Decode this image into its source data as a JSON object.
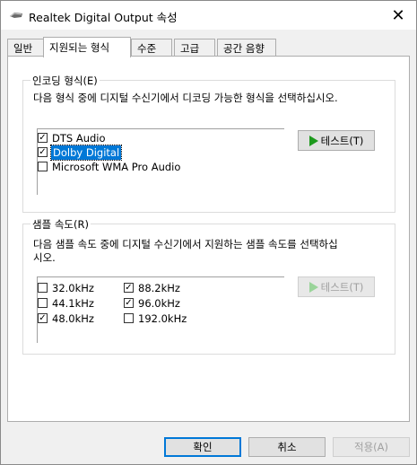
{
  "window": {
    "title": "Realtek Digital Output 속성",
    "close_glyph": "✕"
  },
  "tabs": [
    {
      "label": "일반"
    },
    {
      "label": "지원되는 형식",
      "active": true
    },
    {
      "label": "수준"
    },
    {
      "label": "고급"
    },
    {
      "label": "공간 음향"
    }
  ],
  "encoding": {
    "group_label": "인코딩 형식(E)",
    "description": "다음 형식 중에 디지털 수신기에서 디코딩 가능한 형식을 선택하십시오.",
    "formats": [
      {
        "label": "DTS Audio",
        "checked": true
      },
      {
        "label": "Dolby Digital",
        "checked": true,
        "selected": true
      },
      {
        "label": "Microsoft WMA Pro Audio",
        "checked": false
      }
    ],
    "test_button": "테스트(T)"
  },
  "sample_rate": {
    "group_label": "샘플 속도(R)",
    "description_line1": "다음 샘플 속도 중에 디지털 수신기에서 지원하는 샘플 속도를 선택하십",
    "description_line2": "시오.",
    "rates": [
      {
        "label": "32.0kHz",
        "checked": false
      },
      {
        "label": "44.1kHz",
        "checked": false
      },
      {
        "label": "48.0kHz",
        "checked": true
      },
      {
        "label": "88.2kHz",
        "checked": true
      },
      {
        "label": "96.0kHz",
        "checked": true
      },
      {
        "label": "192.0kHz",
        "checked": false
      }
    ],
    "test_button": "테스트(T)"
  },
  "buttons": {
    "ok": "확인",
    "cancel": "취소",
    "apply": "적용(A)"
  },
  "check_glyph": "✓",
  "colors": {
    "selection": "#0078d7",
    "play": "#1e9a1e",
    "default_border": "#0078d7"
  }
}
